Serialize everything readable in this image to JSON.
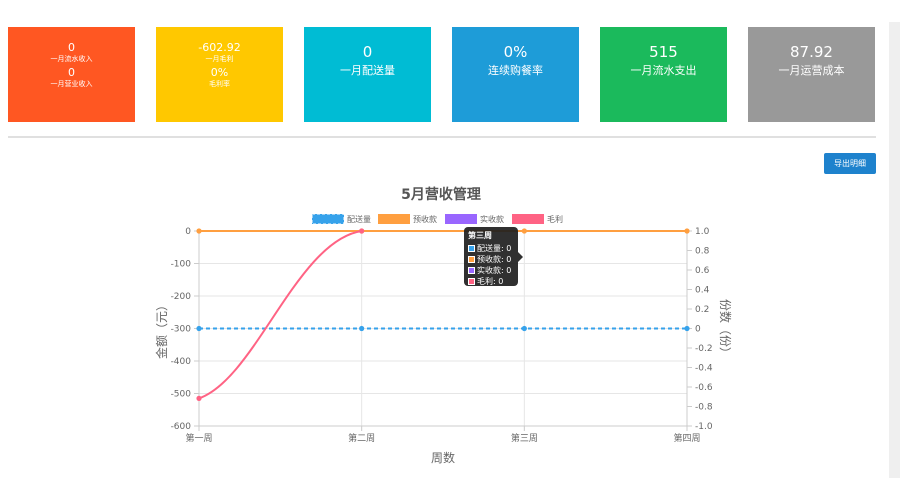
{
  "cards": [
    {
      "color": "#ff5722",
      "stacked": true,
      "items": [
        {
          "value": "0",
          "label": "一月流水收入"
        },
        {
          "value": "0",
          "label": "一月营业收入"
        }
      ]
    },
    {
      "color": "#ffc800",
      "stacked": true,
      "items": [
        {
          "value": "-602.92",
          "label": "一月毛利"
        },
        {
          "value": "0%",
          "label": "毛利率"
        }
      ]
    },
    {
      "color": "#00bcd4",
      "value": "0",
      "label": "一月配送量"
    },
    {
      "color": "#1e9cd8",
      "value": "0%",
      "label": "连续购餐率"
    },
    {
      "color": "#1bba5c",
      "value": "515",
      "label": "一月流水支出"
    },
    {
      "color": "#999999",
      "value": "87.92",
      "label": "一月运营成本"
    }
  ],
  "export_button": "导出明细",
  "tooltip": {
    "title": "第三周",
    "rows": [
      {
        "label": "配送量: 0",
        "color": "#36a2eb"
      },
      {
        "label": "预收款: 0",
        "color": "#ff9f40"
      },
      {
        "label": "实收款: 0",
        "color": "#9966ff"
      },
      {
        "label": "毛利: 0",
        "color": "#ff6384"
      }
    ]
  },
  "chart_data": {
    "type": "line",
    "title": "5月营收管理",
    "xlabel": "周数",
    "ylabel": "金额（元）",
    "y2label": "份数（份）",
    "categories": [
      "第一周",
      "第二周",
      "第三周",
      "第四周"
    ],
    "ylim": [
      -600,
      0
    ],
    "yticks": [
      0,
      -100,
      -200,
      -300,
      -400,
      -500,
      -600
    ],
    "y2lim": [
      -1.0,
      1.0
    ],
    "y2ticks": [
      "1.0",
      "0.8",
      "0.6",
      "0.4",
      "0.2",
      "0",
      "-0.2",
      "-0.4",
      "-0.6",
      "-0.8",
      "-1.0"
    ],
    "grid": true,
    "legend_position": "top",
    "series": [
      {
        "name": "配送量",
        "axis": "right",
        "style": "dashed",
        "color": "#36a2eb",
        "values": [
          0,
          0,
          0,
          0
        ]
      },
      {
        "name": "预收款",
        "axis": "left",
        "style": "solid",
        "color": "#ff9f40",
        "values": [
          0,
          0,
          0,
          0
        ]
      },
      {
        "name": "实收款",
        "axis": "left",
        "style": "solid",
        "color": "#9966ff",
        "values": [
          null,
          null,
          null,
          null
        ]
      },
      {
        "name": "毛利",
        "axis": "left",
        "style": "curve",
        "color": "#ff6384",
        "values": [
          -515,
          0,
          null,
          null
        ]
      }
    ]
  }
}
